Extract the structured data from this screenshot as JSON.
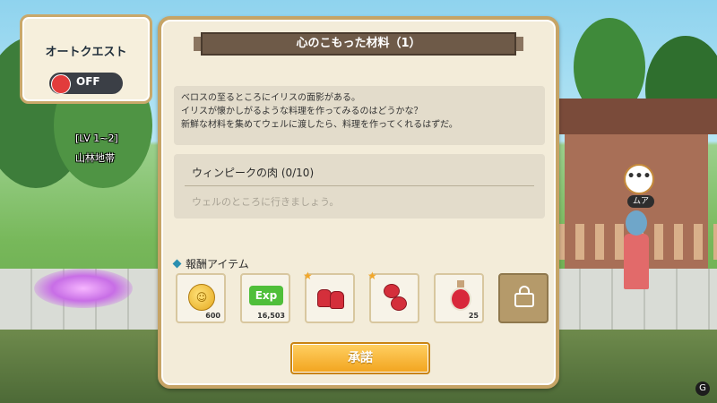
{
  "auto_quest": {
    "title": "オートクエスト",
    "toggle_label": "OFF"
  },
  "area": {
    "level_range": "[LV 1~2]",
    "name": "山林地帯"
  },
  "npc": {
    "name_tag": "ムア",
    "bubble": "•••"
  },
  "quest": {
    "title": "心のこもった材料（1）",
    "description": [
      "ベロスの至るところにイリスの面影がある。",
      "イリスが懐かしがるような料理を作ってみるのはどうかな？",
      "新鮮な材料を集めてウェルに渡したら、料理を作ってくれるはずだ。"
    ],
    "objective": {
      "title": "ウィンピークの肉 (0/10)",
      "hint": "ウェルのところに行きましょう。"
    },
    "reward_header": "報酬アイテム",
    "rewards": [
      {
        "icon": "coin-icon",
        "qty": "600"
      },
      {
        "icon": "exp-icon",
        "label": "Exp",
        "qty": "16,503"
      },
      {
        "icon": "shoes-icon",
        "qty": ""
      },
      {
        "icon": "bag-icon",
        "qty": ""
      },
      {
        "icon": "potion-icon",
        "qty": "25"
      },
      {
        "icon": "lock-icon",
        "qty": ""
      }
    ],
    "accept_label": "承諾"
  },
  "colors": {
    "panel_bg": "#f3ecd9",
    "panel_border": "#c6a466",
    "banner": "#6e5a48",
    "accept_button": "#f2a41e",
    "toggle_off": "#e23c3c"
  }
}
